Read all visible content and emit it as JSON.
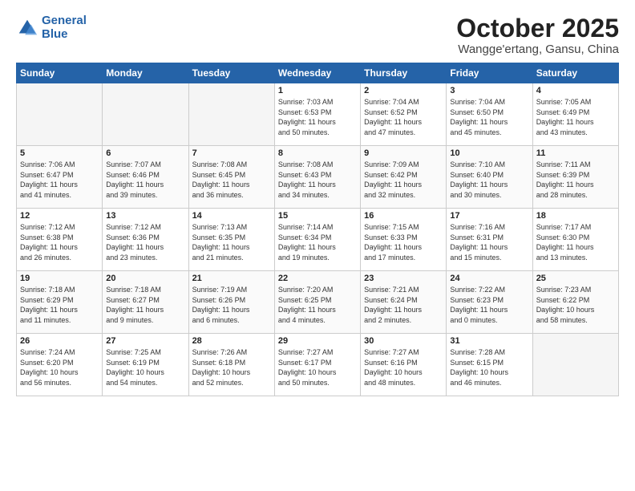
{
  "logo": {
    "line1": "General",
    "line2": "Blue"
  },
  "title": "October 2025",
  "location": "Wangge'ertang, Gansu, China",
  "days_header": [
    "Sunday",
    "Monday",
    "Tuesday",
    "Wednesday",
    "Thursday",
    "Friday",
    "Saturday"
  ],
  "weeks": [
    [
      {
        "day": "",
        "info": ""
      },
      {
        "day": "",
        "info": ""
      },
      {
        "day": "",
        "info": ""
      },
      {
        "day": "1",
        "info": "Sunrise: 7:03 AM\nSunset: 6:53 PM\nDaylight: 11 hours\nand 50 minutes."
      },
      {
        "day": "2",
        "info": "Sunrise: 7:04 AM\nSunset: 6:52 PM\nDaylight: 11 hours\nand 47 minutes."
      },
      {
        "day": "3",
        "info": "Sunrise: 7:04 AM\nSunset: 6:50 PM\nDaylight: 11 hours\nand 45 minutes."
      },
      {
        "day": "4",
        "info": "Sunrise: 7:05 AM\nSunset: 6:49 PM\nDaylight: 11 hours\nand 43 minutes."
      }
    ],
    [
      {
        "day": "5",
        "info": "Sunrise: 7:06 AM\nSunset: 6:47 PM\nDaylight: 11 hours\nand 41 minutes."
      },
      {
        "day": "6",
        "info": "Sunrise: 7:07 AM\nSunset: 6:46 PM\nDaylight: 11 hours\nand 39 minutes."
      },
      {
        "day": "7",
        "info": "Sunrise: 7:08 AM\nSunset: 6:45 PM\nDaylight: 11 hours\nand 36 minutes."
      },
      {
        "day": "8",
        "info": "Sunrise: 7:08 AM\nSunset: 6:43 PM\nDaylight: 11 hours\nand 34 minutes."
      },
      {
        "day": "9",
        "info": "Sunrise: 7:09 AM\nSunset: 6:42 PM\nDaylight: 11 hours\nand 32 minutes."
      },
      {
        "day": "10",
        "info": "Sunrise: 7:10 AM\nSunset: 6:40 PM\nDaylight: 11 hours\nand 30 minutes."
      },
      {
        "day": "11",
        "info": "Sunrise: 7:11 AM\nSunset: 6:39 PM\nDaylight: 11 hours\nand 28 minutes."
      }
    ],
    [
      {
        "day": "12",
        "info": "Sunrise: 7:12 AM\nSunset: 6:38 PM\nDaylight: 11 hours\nand 26 minutes."
      },
      {
        "day": "13",
        "info": "Sunrise: 7:12 AM\nSunset: 6:36 PM\nDaylight: 11 hours\nand 23 minutes."
      },
      {
        "day": "14",
        "info": "Sunrise: 7:13 AM\nSunset: 6:35 PM\nDaylight: 11 hours\nand 21 minutes."
      },
      {
        "day": "15",
        "info": "Sunrise: 7:14 AM\nSunset: 6:34 PM\nDaylight: 11 hours\nand 19 minutes."
      },
      {
        "day": "16",
        "info": "Sunrise: 7:15 AM\nSunset: 6:33 PM\nDaylight: 11 hours\nand 17 minutes."
      },
      {
        "day": "17",
        "info": "Sunrise: 7:16 AM\nSunset: 6:31 PM\nDaylight: 11 hours\nand 15 minutes."
      },
      {
        "day": "18",
        "info": "Sunrise: 7:17 AM\nSunset: 6:30 PM\nDaylight: 11 hours\nand 13 minutes."
      }
    ],
    [
      {
        "day": "19",
        "info": "Sunrise: 7:18 AM\nSunset: 6:29 PM\nDaylight: 11 hours\nand 11 minutes."
      },
      {
        "day": "20",
        "info": "Sunrise: 7:18 AM\nSunset: 6:27 PM\nDaylight: 11 hours\nand 9 minutes."
      },
      {
        "day": "21",
        "info": "Sunrise: 7:19 AM\nSunset: 6:26 PM\nDaylight: 11 hours\nand 6 minutes."
      },
      {
        "day": "22",
        "info": "Sunrise: 7:20 AM\nSunset: 6:25 PM\nDaylight: 11 hours\nand 4 minutes."
      },
      {
        "day": "23",
        "info": "Sunrise: 7:21 AM\nSunset: 6:24 PM\nDaylight: 11 hours\nand 2 minutes."
      },
      {
        "day": "24",
        "info": "Sunrise: 7:22 AM\nSunset: 6:23 PM\nDaylight: 11 hours\nand 0 minutes."
      },
      {
        "day": "25",
        "info": "Sunrise: 7:23 AM\nSunset: 6:22 PM\nDaylight: 10 hours\nand 58 minutes."
      }
    ],
    [
      {
        "day": "26",
        "info": "Sunrise: 7:24 AM\nSunset: 6:20 PM\nDaylight: 10 hours\nand 56 minutes."
      },
      {
        "day": "27",
        "info": "Sunrise: 7:25 AM\nSunset: 6:19 PM\nDaylight: 10 hours\nand 54 minutes."
      },
      {
        "day": "28",
        "info": "Sunrise: 7:26 AM\nSunset: 6:18 PM\nDaylight: 10 hours\nand 52 minutes."
      },
      {
        "day": "29",
        "info": "Sunrise: 7:27 AM\nSunset: 6:17 PM\nDaylight: 10 hours\nand 50 minutes."
      },
      {
        "day": "30",
        "info": "Sunrise: 7:27 AM\nSunset: 6:16 PM\nDaylight: 10 hours\nand 48 minutes."
      },
      {
        "day": "31",
        "info": "Sunrise: 7:28 AM\nSunset: 6:15 PM\nDaylight: 10 hours\nand 46 minutes."
      },
      {
        "day": "",
        "info": ""
      }
    ]
  ]
}
